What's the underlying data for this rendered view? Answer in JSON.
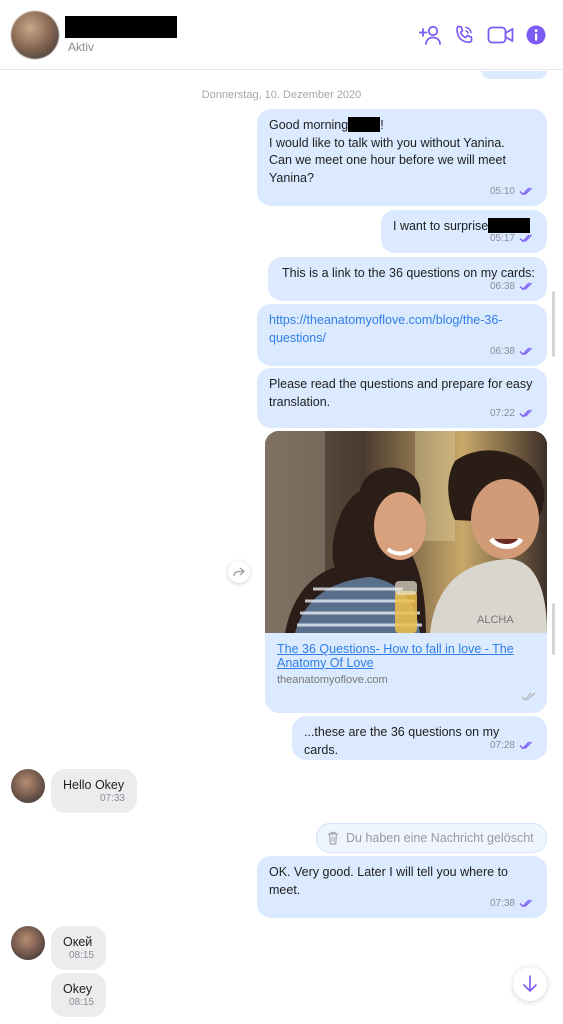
{
  "header": {
    "status": "Aktiv",
    "icons": [
      "add-person-icon",
      "phone-icon",
      "video-icon",
      "info-icon"
    ],
    "accent": "#7c5cf5"
  },
  "chat": {
    "date_separator": "Donnerstag, 10. Dezember 2020",
    "messages": [
      {
        "line1": "Good morning",
        "line1_end": "!",
        "line2": "I would like to talk with you without Yanina.",
        "line3": "Can we meet one hour before we will meet",
        "line4": "Yanina?",
        "time": "05:10"
      },
      {
        "text": "I want to surprise",
        "time": "05:17"
      },
      {
        "text": "This is a link to the 36 questions on my cards:",
        "time": "06:38"
      },
      {
        "line1": "https://theanatomyoflove.com/blog/the-36-",
        "line2": "questions/",
        "time": "06:38"
      },
      {
        "line1": "Please read the questions and prepare for easy",
        "line2": "translation.",
        "time": "07:22"
      },
      {
        "link_line1": "The 36 Questions- How to fall in love - The",
        "link_line2": "Anatomy Of Love",
        "domain": "theanatomyoflove.com"
      },
      {
        "text": "...these are the 36 questions on my cards.",
        "time": "07:28"
      },
      {
        "text": "Hello Okey",
        "time": "07:33"
      },
      {
        "text": "Du haben eine Nachricht gelöscht"
      },
      {
        "line1": "OK. Very good. Later I will tell you where to",
        "line2": "meet.",
        "time": "07:38"
      },
      {
        "text": "Окей",
        "time": "08:15"
      },
      {
        "text": "Okey",
        "time": "08:15"
      }
    ]
  },
  "colors": {
    "outgoing": "#dbeaff",
    "incoming": "#ececef",
    "link": "#2f7ee8",
    "check": "#7c5cf5"
  }
}
